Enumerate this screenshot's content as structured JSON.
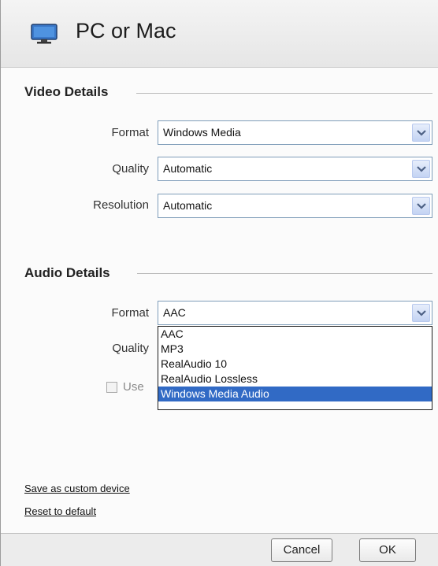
{
  "window": {
    "title": "PC or Mac",
    "icon": "monitor-icon"
  },
  "video": {
    "heading": "Video Details",
    "format": {
      "label": "Format",
      "value": "Windows Media"
    },
    "quality": {
      "label": "Quality",
      "value": "Automatic"
    },
    "resolution": {
      "label": "Resolution",
      "value": "Automatic"
    }
  },
  "audio": {
    "heading": "Audio Details",
    "format": {
      "label": "Format",
      "value": "AAC"
    },
    "quality": {
      "label": "Quality"
    },
    "checkbox": {
      "label": "Use",
      "checked": false
    },
    "dropdown": {
      "options": [
        "AAC",
        "MP3",
        "RealAudio 10",
        "RealAudio Lossless",
        "Windows Media Audio"
      ],
      "highlighted": "Windows Media Audio"
    }
  },
  "links": {
    "save_custom": "Save as custom device",
    "reset": "Reset to default"
  },
  "buttons": {
    "cancel": "Cancel",
    "ok": "OK"
  },
  "colors": {
    "highlight": "#316ac5",
    "select_border": "#7f9db9"
  }
}
